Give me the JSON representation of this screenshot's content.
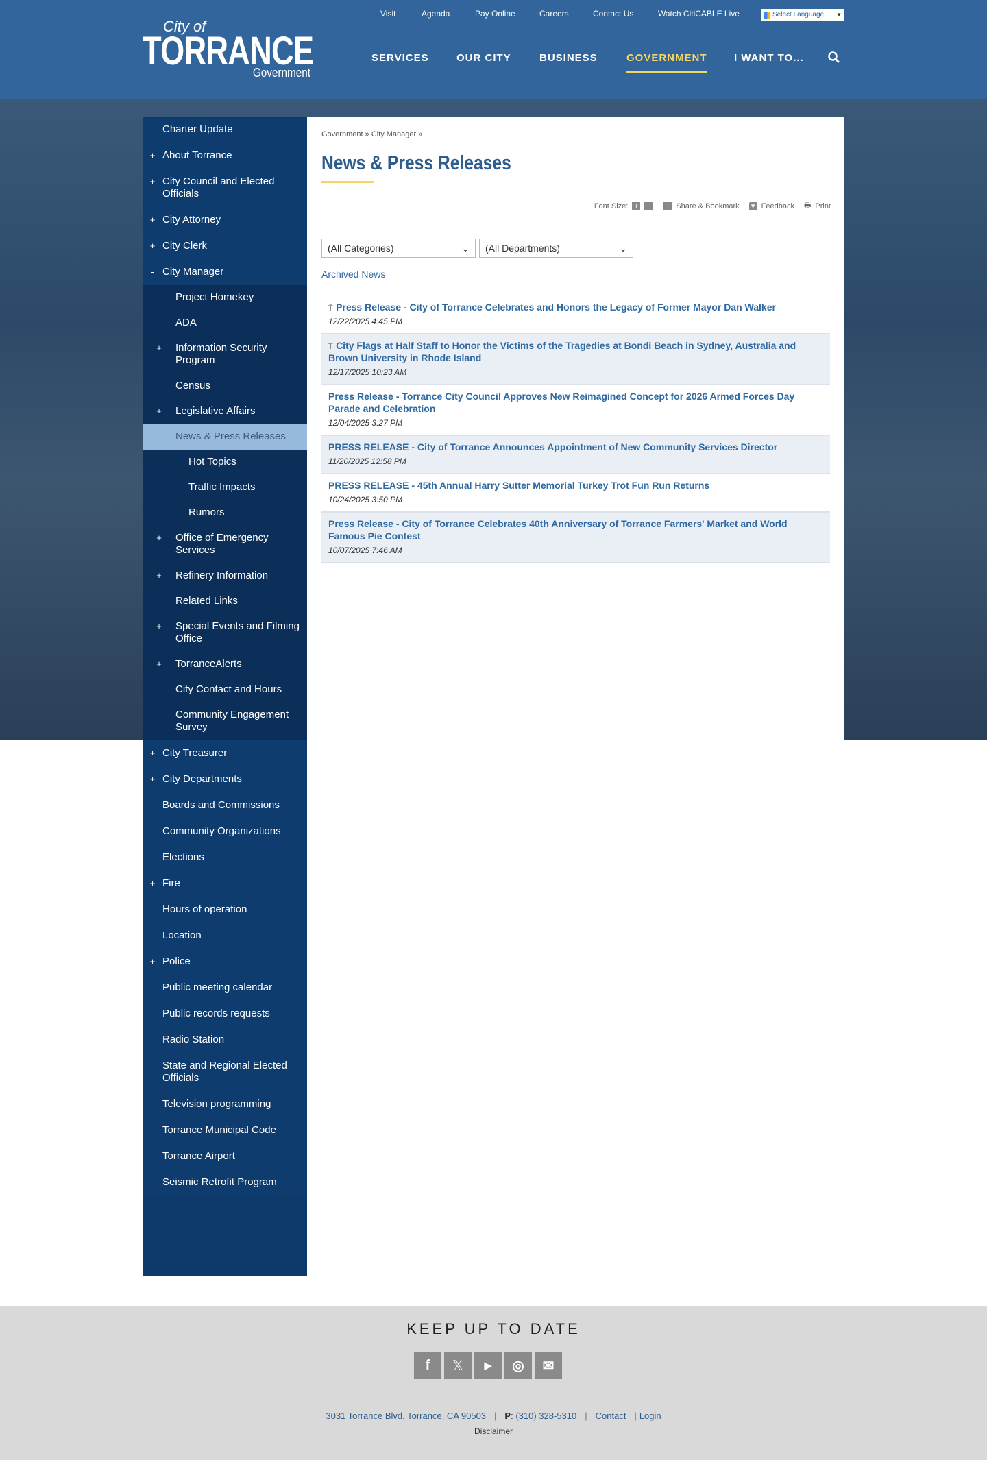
{
  "logo": {
    "city_of": "City of",
    "name": "TORRANCE",
    "sub": "Government"
  },
  "utility_links": [
    "Visit",
    "Agenda",
    "Pay Online",
    "Careers",
    "Contact Us",
    "Watch CitiCABLE Live"
  ],
  "language": "Select Language",
  "nav": [
    "SERVICES",
    "OUR CITY",
    "BUSINESS",
    "GOVERNMENT",
    "I WANT TO..."
  ],
  "sidebar": [
    {
      "label": "Charter Update",
      "level": 1,
      "pm": ""
    },
    {
      "label": "About Torrance",
      "level": 1,
      "pm": "+"
    },
    {
      "label": "City Council and Elected Officials",
      "level": 1,
      "pm": "+"
    },
    {
      "label": "City Attorney",
      "level": 1,
      "pm": "+"
    },
    {
      "label": "City Clerk",
      "level": 1,
      "pm": "+"
    },
    {
      "label": "City Manager",
      "level": 1,
      "pm": "-"
    },
    {
      "label": "Project Homekey",
      "level": 2,
      "pm": ""
    },
    {
      "label": "ADA",
      "level": 2,
      "pm": ""
    },
    {
      "label": "Information Security Program",
      "level": 2,
      "pm": "+"
    },
    {
      "label": "Census",
      "level": 2,
      "pm": ""
    },
    {
      "label": "Legislative Affairs",
      "level": 2,
      "pm": "+"
    },
    {
      "label": "News & Press Releases",
      "level": 2,
      "pm": "-",
      "active": true
    },
    {
      "label": "Hot Topics",
      "level": 3,
      "pm": ""
    },
    {
      "label": "Traffic Impacts",
      "level": 3,
      "pm": ""
    },
    {
      "label": "Rumors",
      "level": 3,
      "pm": ""
    },
    {
      "label": "Office of Emergency Services",
      "level": 2,
      "pm": "+"
    },
    {
      "label": "Refinery Information",
      "level": 2,
      "pm": "+"
    },
    {
      "label": "Related Links",
      "level": 2,
      "pm": ""
    },
    {
      "label": "Special Events and Filming Office",
      "level": 2,
      "pm": "+"
    },
    {
      "label": "TorranceAlerts",
      "level": 2,
      "pm": "+"
    },
    {
      "label": "City Contact and Hours",
      "level": 2,
      "pm": ""
    },
    {
      "label": "Community Engagement Survey",
      "level": 2,
      "pm": ""
    },
    {
      "label": "City Treasurer",
      "level": 1,
      "pm": "+"
    },
    {
      "label": "City Departments",
      "level": 1,
      "pm": "+"
    },
    {
      "label": "Boards and Commissions",
      "level": 1,
      "pm": ""
    },
    {
      "label": "Community Organizations",
      "level": 1,
      "pm": ""
    },
    {
      "label": "Elections",
      "level": 1,
      "pm": ""
    },
    {
      "label": "Fire",
      "level": 1,
      "pm": "+"
    },
    {
      "label": "Hours of operation",
      "level": 1,
      "pm": ""
    },
    {
      "label": "Location",
      "level": 1,
      "pm": ""
    },
    {
      "label": "Police",
      "level": 1,
      "pm": "+"
    },
    {
      "label": "Public meeting calendar",
      "level": 1,
      "pm": ""
    },
    {
      "label": "Public records requests",
      "level": 1,
      "pm": ""
    },
    {
      "label": "Radio Station",
      "level": 1,
      "pm": ""
    },
    {
      "label": "State and Regional Elected Officials",
      "level": 1,
      "pm": ""
    },
    {
      "label": "Television programming",
      "level": 1,
      "pm": ""
    },
    {
      "label": "Torrance Municipal Code",
      "level": 1,
      "pm": ""
    },
    {
      "label": "Torrance Airport",
      "level": 1,
      "pm": ""
    },
    {
      "label": "Seismic Retrofit Program",
      "level": 1,
      "pm": ""
    }
  ],
  "breadcrumb": [
    "Government",
    "City Manager"
  ],
  "page_title": "News & Press Releases",
  "tools": {
    "font_size": "Font Size:",
    "share": "Share & Bookmark",
    "feedback": "Feedback",
    "print": "Print"
  },
  "filters": {
    "category": "(All Categories)",
    "department": "(All Departments)"
  },
  "archived": "Archived News",
  "news": [
    {
      "title": "Press Release - City of Torrance Celebrates and Honors the Legacy of Former Mayor Dan Walker",
      "date": "12/22/2025 4:45 PM",
      "pinned": true
    },
    {
      "title": "City Flags at Half Staff to Honor the Victims of the Tragedies at Bondi Beach in Sydney, Australia and Brown University in Rhode Island",
      "date": "12/17/2025 10:23 AM",
      "pinned": true
    },
    {
      "title": "Press Release - Torrance City Council Approves New Reimagined Concept for 2026 Armed Forces Day Parade and Celebration",
      "date": "12/04/2025 3:27 PM",
      "pinned": false
    },
    {
      "title": "PRESS RELEASE - City of Torrance Announces Appointment of New Community Services Director",
      "date": "11/20/2025 12:58 PM",
      "pinned": false
    },
    {
      "title": "PRESS RELEASE - 45th Annual Harry Sutter Memorial Turkey Trot Fun Run Returns",
      "date": "10/24/2025 3:50 PM",
      "pinned": false
    },
    {
      "title": "Press Release - City of Torrance Celebrates 40th Anniversary of Torrance Farmers' Market and World Famous Pie Contest",
      "date": "10/07/2025 7:46 AM",
      "pinned": false
    }
  ],
  "footer": {
    "heading": "KEEP UP TO DATE",
    "address": "3031 Torrance Blvd, Torrance, CA 90503",
    "phone_label": "P",
    "phone": "(310) 328-5310",
    "contact": "Contact",
    "login": "Login",
    "disclaimer": "Disclaimer"
  }
}
